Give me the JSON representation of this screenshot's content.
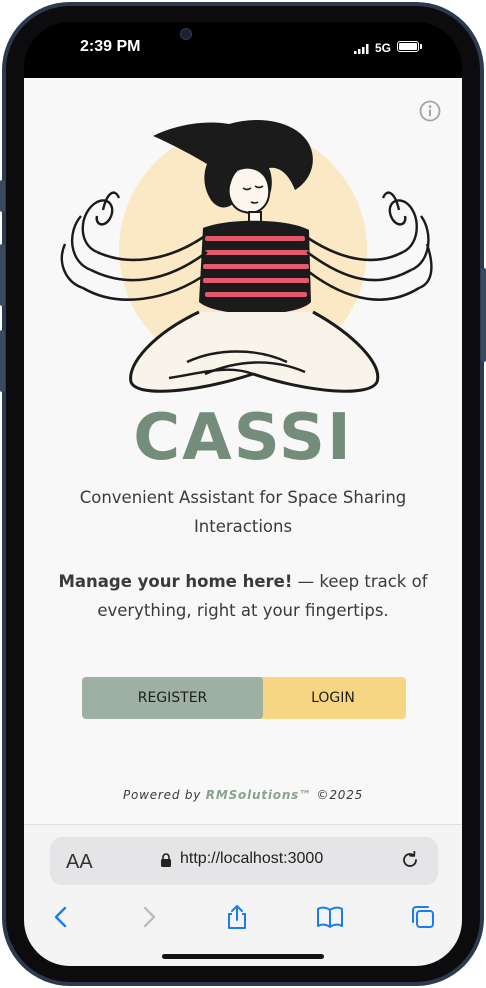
{
  "status_bar": {
    "time": "2:39 PM",
    "network": "5G"
  },
  "app": {
    "brand": "CASSI",
    "subtitle": "Convenient Assistant for Space Sharing Interactions",
    "tagline_bold": "Manage your home here!",
    "tagline_rest": " — keep track of everything, right at your fingertips.",
    "register_label": "REGISTER",
    "login_label": "LOGIN",
    "footer_prefix": "Powered by ",
    "footer_company": "RMSolutions™",
    "footer_suffix": " ©2025",
    "colors": {
      "brand": "#748c7a",
      "register": "#9db0a2",
      "login": "#f6d682",
      "sun": "#fbe8c5",
      "stripes": "#e45a6b"
    },
    "icons": {
      "info": "info-icon",
      "hero": "meditating-person-illustration"
    }
  },
  "browser": {
    "text_size_label": "AA",
    "url": "http://localhost:3000",
    "icons": [
      "back-icon",
      "forward-icon",
      "share-icon",
      "bookmarks-icon",
      "tabs-icon",
      "reload-icon",
      "lock-icon"
    ]
  }
}
